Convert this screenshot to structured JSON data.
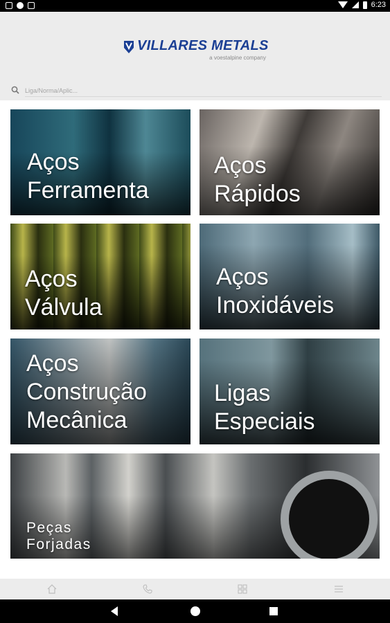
{
  "status_bar": {
    "time": "6:23"
  },
  "header": {
    "logo_title": "VILLARES METALS",
    "logo_subtitle": "a voestalpine company",
    "brand_color": "#1b3f94"
  },
  "search": {
    "placeholder": "Liga/Norma/Aplic..."
  },
  "tiles": [
    {
      "lines": [
        "Aços",
        "Ferramenta"
      ]
    },
    {
      "lines": [
        "Aços",
        "Rápidos"
      ]
    },
    {
      "lines": [
        "Aços",
        "Válvula"
      ]
    },
    {
      "lines": [
        "Aços",
        "Inoxidáveis"
      ]
    },
    {
      "lines": [
        "Aços",
        "Construção",
        "Mecânica"
      ]
    },
    {
      "lines": [
        "Ligas",
        "Especiais"
      ]
    },
    {
      "lines": [
        "Peças",
        "Forjadas"
      ]
    }
  ],
  "bottom_nav": {
    "icons": [
      "home-icon",
      "phone-icon",
      "grid-icon",
      "menu-icon"
    ]
  },
  "system_nav": {
    "icons": [
      "back-icon",
      "home-icon",
      "recents-icon"
    ]
  }
}
